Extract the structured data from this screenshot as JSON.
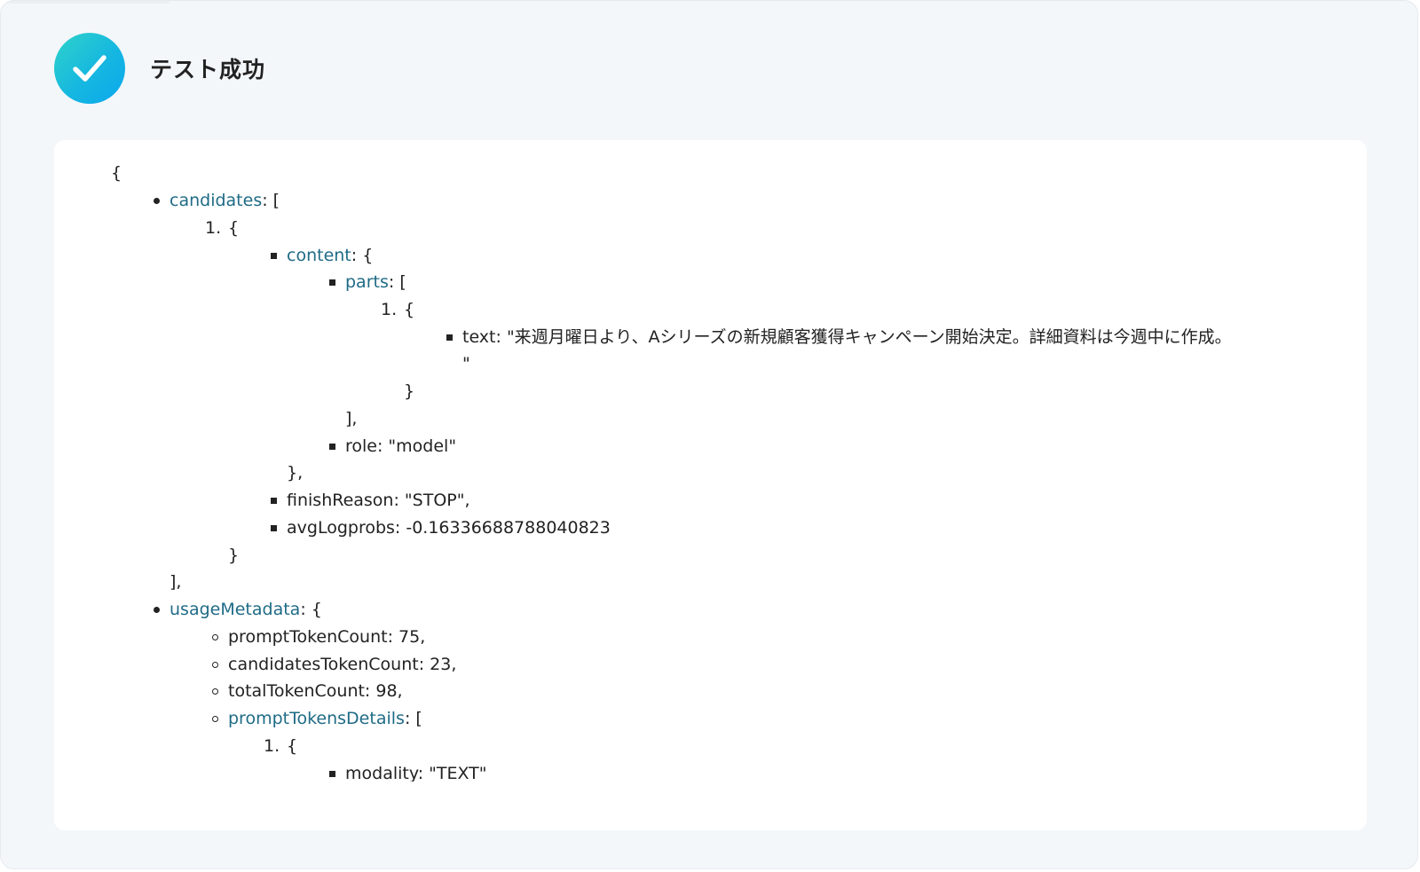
{
  "status": {
    "title": "テスト成功",
    "icon": "check-circle-icon",
    "accent_color": "#16b7e0"
  },
  "json_lines": [
    {
      "bullet": "",
      "key": "",
      "text": "{"
    },
    {
      "bullet": "disc",
      "key": "candidates",
      "text": ": ["
    },
    {
      "bullet": "1.",
      "key": "",
      "text": "{"
    },
    {
      "bullet": "square",
      "key": "content",
      "text": ": {"
    },
    {
      "bullet": "square",
      "key": "parts",
      "text": ": ["
    },
    {
      "bullet": "1.",
      "key": "",
      "text": "{"
    },
    {
      "bullet": "square",
      "key": "",
      "text": "text: \"来週月曜日より、Aシリーズの新規顧客獲得キャンペーン開始決定。詳細資料は今週中に作成。"
    },
    {
      "bullet": "",
      "key": "",
      "text": "\""
    },
    {
      "bullet": "",
      "key": "",
      "text": "}"
    },
    {
      "bullet": "",
      "key": "",
      "text": "],"
    },
    {
      "bullet": "square",
      "key": "",
      "text": "role: \"model\""
    },
    {
      "bullet": "",
      "key": "",
      "text": "},"
    },
    {
      "bullet": "square",
      "key": "",
      "text": "finishReason: \"STOP\","
    },
    {
      "bullet": "square",
      "key": "",
      "text": "avgLogprobs: -0.16336688788040823"
    },
    {
      "bullet": "",
      "key": "",
      "text": "}"
    },
    {
      "bullet": "",
      "key": "",
      "text": "],"
    },
    {
      "bullet": "disc",
      "key": "usageMetadata",
      "text": ": {"
    },
    {
      "bullet": "circle",
      "key": "",
      "text": "promptTokenCount: 75,"
    },
    {
      "bullet": "circle",
      "key": "",
      "text": "candidatesTokenCount: 23,"
    },
    {
      "bullet": "circle",
      "key": "",
      "text": "totalTokenCount: 98,"
    },
    {
      "bullet": "circle",
      "key": "promptTokensDetails",
      "text": ": ["
    },
    {
      "bullet": "1.",
      "key": "",
      "text": "{"
    },
    {
      "bullet": "square",
      "key": "",
      "text": "modality: \"TEXT\""
    }
  ]
}
